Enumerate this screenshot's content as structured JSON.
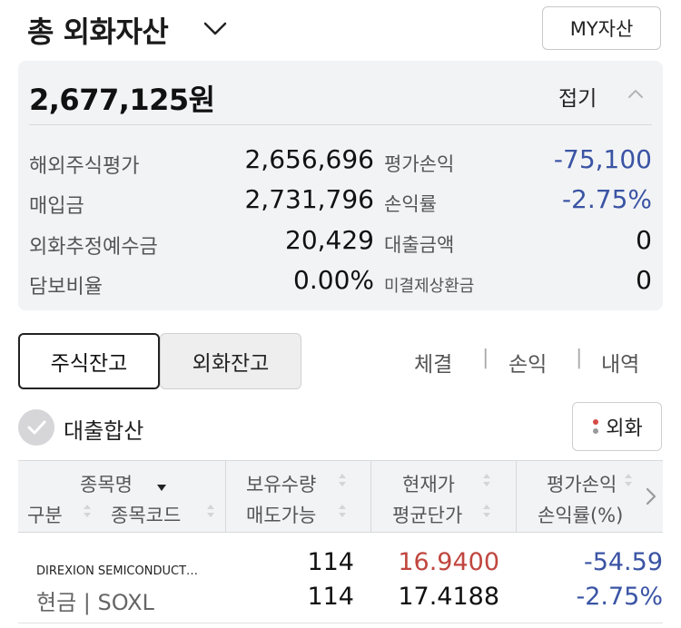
{
  "header": {
    "title": "총 외화자산",
    "my_button": "MY자산"
  },
  "summary": {
    "total": "2,677,125원",
    "collapse_label": "접기",
    "rows": [
      {
        "label": "해외주식평가",
        "value": "2,656,696",
        "label2": "평가손익",
        "value2": "-75,100"
      },
      {
        "label": "매입금",
        "value": "2,731,796",
        "label2": "손익률",
        "value2": "-2.75%"
      },
      {
        "label": "외화추정예수금",
        "value": "20,429",
        "label2": "대출금액",
        "value2": "0"
      },
      {
        "label": "담보비율",
        "value": "0.00%",
        "label2": "미결제상환금",
        "value2": "0"
      }
    ]
  },
  "tabs": {
    "stock_balance": "주식잔고",
    "fx_balance": "외화잔고"
  },
  "links": {
    "execution": "체결",
    "pnl": "손익",
    "history": "내역",
    "separator": "|"
  },
  "loan_sum": {
    "label": "대출합산"
  },
  "fx_button": "외화",
  "table": {
    "headers": {
      "name": "종목명",
      "type": "구분",
      "code": "종목코드",
      "holding_qty": "보유수량",
      "sellable": "매도가능",
      "current_price": "현재가",
      "avg_price": "평균단가",
      "eval_pnl": "평가손익",
      "pnl_rate": "손익률(%)"
    },
    "rows": [
      {
        "name": "DIREXION SEMICONDUCT…",
        "type_code": "현금 | SOXL",
        "holding_qty": "114",
        "sellable": "114",
        "current_price": "16.9400",
        "avg_price": "17.4188",
        "eval_pnl": "-54.59",
        "pnl_rate": "-2.75%"
      }
    ]
  },
  "colors": {
    "negative_blue": "#3a54a4",
    "price_red": "#c0463f",
    "card_bg": "#f2f3f5"
  }
}
